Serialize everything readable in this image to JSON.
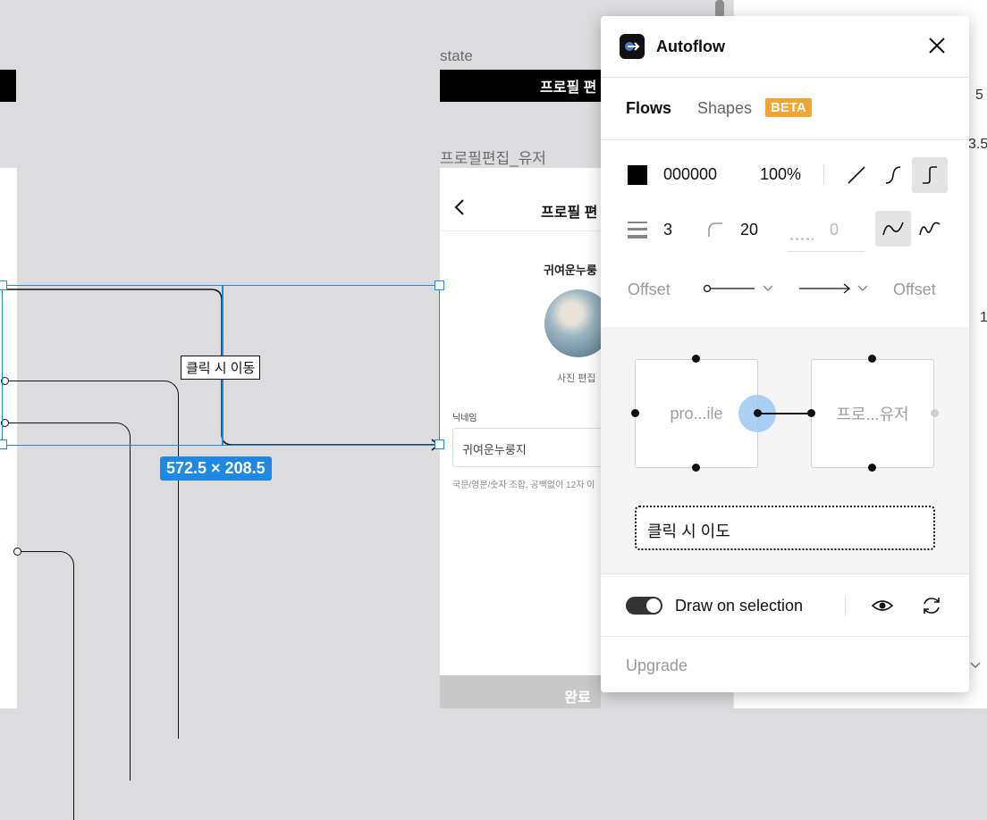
{
  "canvas": {
    "state_label": "state",
    "state_bar_text": "프로필 편",
    "frame2_label": "프로필편집_유저",
    "phone_title": "프로필 편",
    "username": "귀여운누룽",
    "photo_edit": "사진 편집",
    "nickname_label": "닉네임",
    "nickname_value": "귀여운누룽지",
    "hint_text": "국문/영문/숫자 조합, 공백없이 12자 이",
    "done_button": "완료",
    "connector_label": "클릭 시 이동",
    "dimensions": "572.5 × 208.5"
  },
  "right_sidebar": {
    "values": [
      "5",
      "3.5",
      "1"
    ]
  },
  "plugin": {
    "title": "Autoflow",
    "tabs": [
      {
        "label": "Flows",
        "active": true
      },
      {
        "label": "Shapes",
        "badge": "BETA"
      }
    ],
    "stroke": {
      "color_hex": "000000",
      "opacity": "100%",
      "weight": "3",
      "corner_radius": "20",
      "dash": "0"
    },
    "offset_left": "Offset",
    "offset_right": "Offset",
    "preview": {
      "source_name": "pro...ile",
      "target_name": "프로...유저",
      "label_input": "클릭 시 이도"
    },
    "draw_on_selection": "Draw on selection",
    "upgrade": "Upgrade",
    "colors": {
      "accent": "#1e88e5",
      "badge": "#f2a531",
      "selection_bubble": "#9cc8f5"
    }
  }
}
